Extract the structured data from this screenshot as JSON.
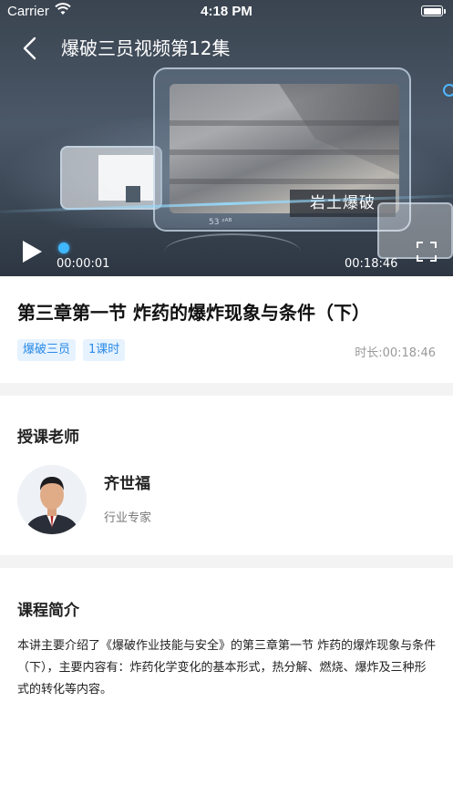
{
  "status_bar": {
    "carrier": "Carrier",
    "time": "4:18 PM"
  },
  "video": {
    "title": "爆破三员视频第12集",
    "overlay_caption": "岩土爆破",
    "overlay_micro_label": "53 ᶻᴬᴮ",
    "current_time": "00:00:01",
    "total_time": "00:18:46",
    "progress_fraction": 0.0,
    "accent_color": "#3fb8ff"
  },
  "lesson": {
    "title": "第三章第一节 炸药的爆炸现象与条件（下）",
    "tags": [
      "爆破三员",
      "1课时"
    ],
    "duration_text": "时长:00:18:46"
  },
  "teacher_section": {
    "heading": "授课老师",
    "name": "齐世福",
    "role": "行业专家"
  },
  "intro_section": {
    "heading": "课程简介",
    "text": "本讲主要介绍了《爆破作业技能与安全》的第三章第一节 炸药的爆炸现象与条件（下），主要内容有：炸药化学变化的基本形式，热分解、燃烧、爆炸及三种形式的转化等内容。"
  },
  "icons": {
    "back": "chevron-left-icon",
    "play": "play-icon",
    "fullscreen": "fullscreen-icon",
    "wifi": "wifi-icon",
    "battery": "battery-icon"
  },
  "colors": {
    "tag_background": "#e6f3ff",
    "tag_text": "#2b8ae6",
    "divider": "#f3f3f3"
  }
}
